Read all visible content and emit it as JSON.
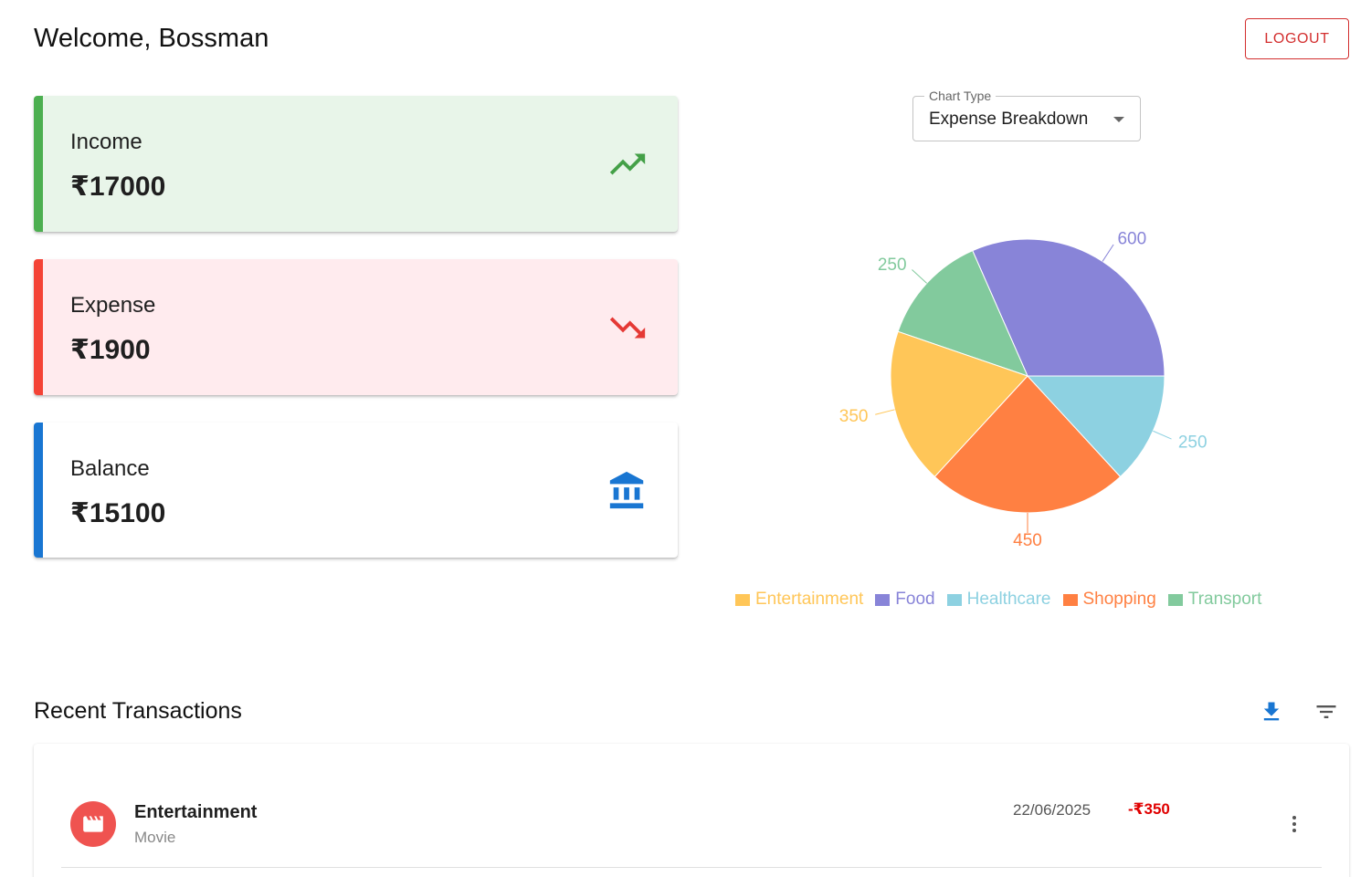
{
  "header": {
    "welcome": "Welcome, Bossman",
    "logout_label": "LOGOUT"
  },
  "cards": {
    "income": {
      "label": "Income",
      "amount": "₹17000",
      "icon": "trending-up-icon",
      "color": "#4caf50"
    },
    "expense": {
      "label": "Expense",
      "amount": "₹1900",
      "icon": "trending-down-icon",
      "color": "#f44336"
    },
    "balance": {
      "label": "Balance",
      "amount": "₹15100",
      "icon": "bank-icon",
      "color": "#1976d2"
    }
  },
  "chart_select": {
    "legend": "Chart Type",
    "value": "Expense Breakdown"
  },
  "chart_data": {
    "type": "pie",
    "categories": [
      "Entertainment",
      "Food",
      "Healthcare",
      "Shopping",
      "Transport"
    ],
    "values": [
      350,
      600,
      250,
      450,
      250
    ],
    "colors": [
      "#ffc658",
      "#8884d8",
      "#8dd1e1",
      "#ff8042",
      "#82ca9d"
    ],
    "legend_position": "bottom"
  },
  "transactions": {
    "title": "Recent Transactions",
    "download_icon": "download-icon",
    "filter_icon": "filter-icon",
    "items": [
      {
        "category": "Entertainment",
        "description": "Movie",
        "date": "22/06/2025",
        "amount": "-₹350",
        "icon": "movie-icon"
      }
    ]
  }
}
